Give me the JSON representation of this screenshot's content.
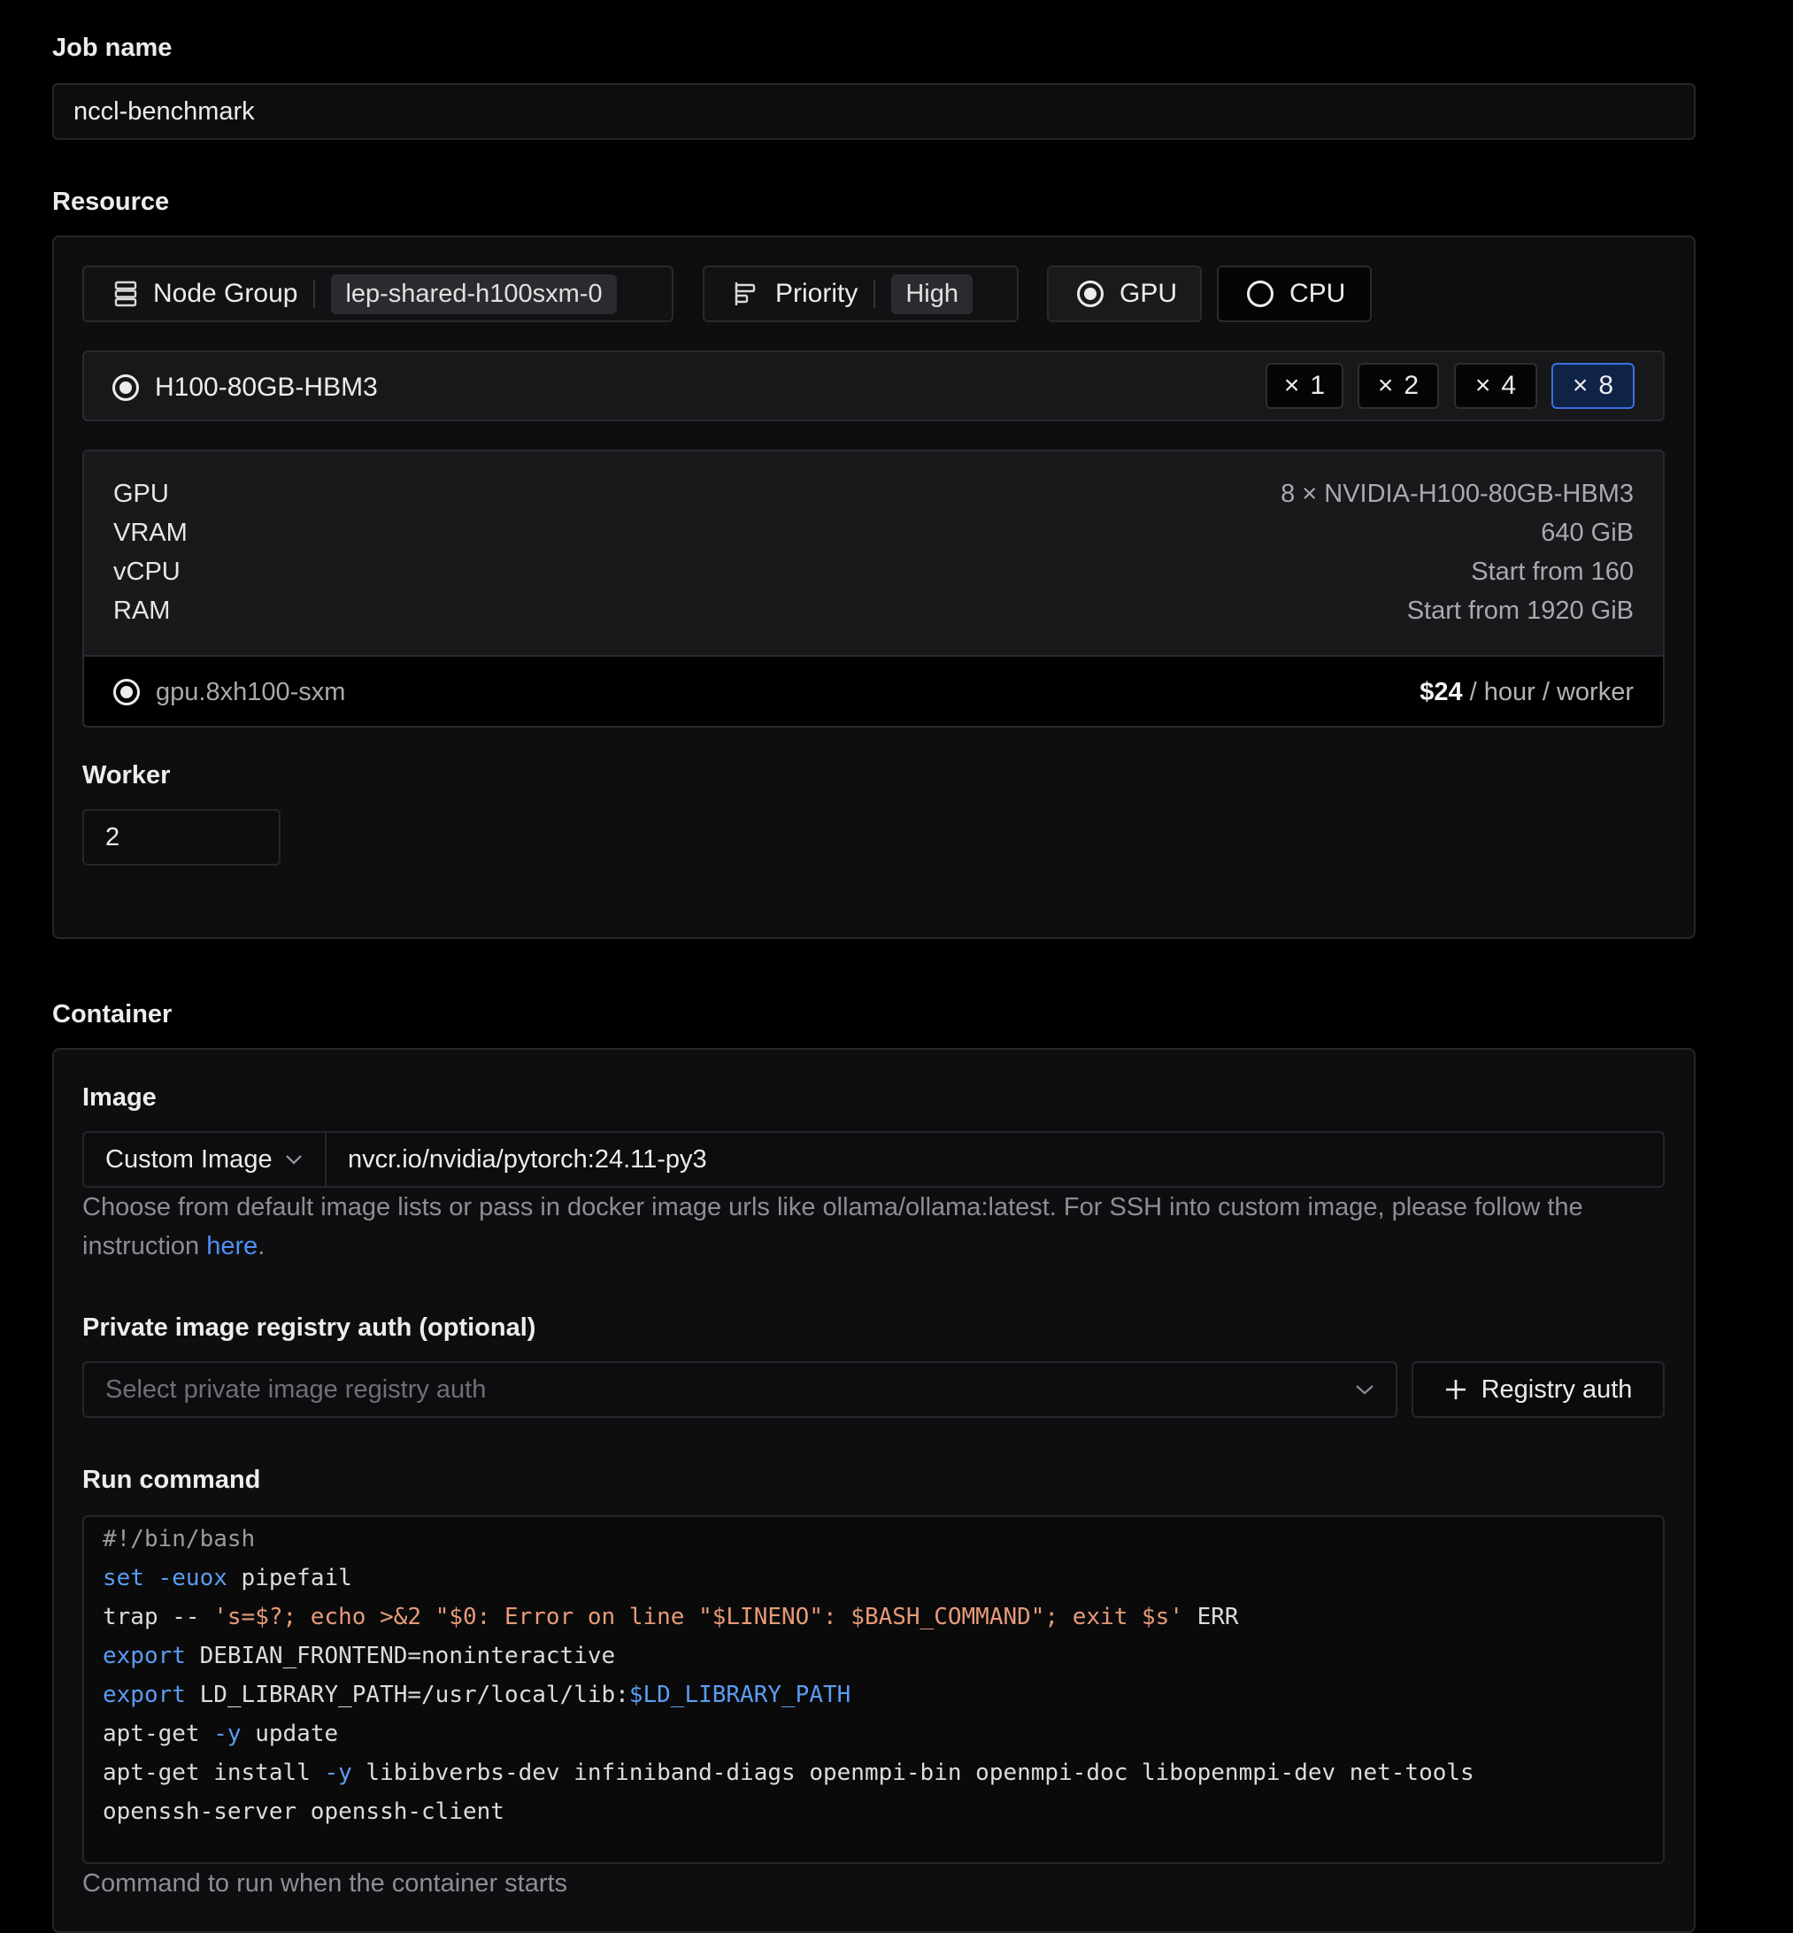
{
  "job_name": {
    "label": "Job name",
    "value": "nccl-benchmark"
  },
  "resource": {
    "label": "Resource",
    "node_group": {
      "label": "Node Group",
      "value": "lep-shared-h100sxm-0"
    },
    "priority": {
      "label": "Priority",
      "value": "High"
    },
    "accelerator": {
      "gpu_label": "GPU",
      "cpu_label": "CPU",
      "selected": "GPU"
    },
    "gpu_model": "H100-80GB-HBM3",
    "multipliers": [
      {
        "symbol": "×",
        "value": "1"
      },
      {
        "symbol": "×",
        "value": "2"
      },
      {
        "symbol": "×",
        "value": "4"
      },
      {
        "symbol": "×",
        "value": "8"
      }
    ],
    "selected_multiplier": "8",
    "specs": [
      {
        "key": "GPU",
        "value": "8 × NVIDIA-H100-80GB-HBM3"
      },
      {
        "key": "VRAM",
        "value": "640 GiB"
      },
      {
        "key": "vCPU",
        "value": "Start from 160"
      },
      {
        "key": "RAM",
        "value": "Start from 1920 GiB"
      }
    ],
    "instance": {
      "name": "gpu.8xh100-sxm",
      "price": "$24",
      "unit": " / hour / worker"
    },
    "worker": {
      "label": "Worker",
      "value": "2"
    }
  },
  "container": {
    "label": "Container",
    "image": {
      "label": "Image",
      "type": "Custom Image",
      "value": "nvcr.io/nvidia/pytorch:24.11-py3",
      "help_text": "Choose from default image lists or pass in docker image urls like ollama/ollama:latest. For SSH into custom image, please follow the instruction ",
      "help_link": "here",
      "help_end": "."
    },
    "registry": {
      "label": "Private image registry auth (optional)",
      "placeholder": "Select private image registry auth",
      "button": "Registry auth"
    },
    "run_command": {
      "label": "Run command",
      "lines": [
        "#!/bin/bash",
        "set -euox pipefail",
        "trap -- 's=$?; echo >&2 \"$0: Error on line \"$LINENO\": $BASH_COMMAND\"; exit $s' ERR",
        "",
        "export DEBIAN_FRONTEND=noninteractive",
        "export LD_LIBRARY_PATH=/usr/local/lib:$LD_LIBRARY_PATH",
        "apt-get -y update",
        "apt-get install -y libibverbs-dev infiniband-diags openmpi-bin openmpi-doc libopenmpi-dev net-tools",
        "openssh-server openssh-client"
      ],
      "help": "Command to run when the container starts"
    }
  },
  "colors": {
    "accent": "#3b6fe0",
    "link": "#4f8ff7",
    "keyword": "#5b9cf0",
    "string": "#e69a78"
  }
}
